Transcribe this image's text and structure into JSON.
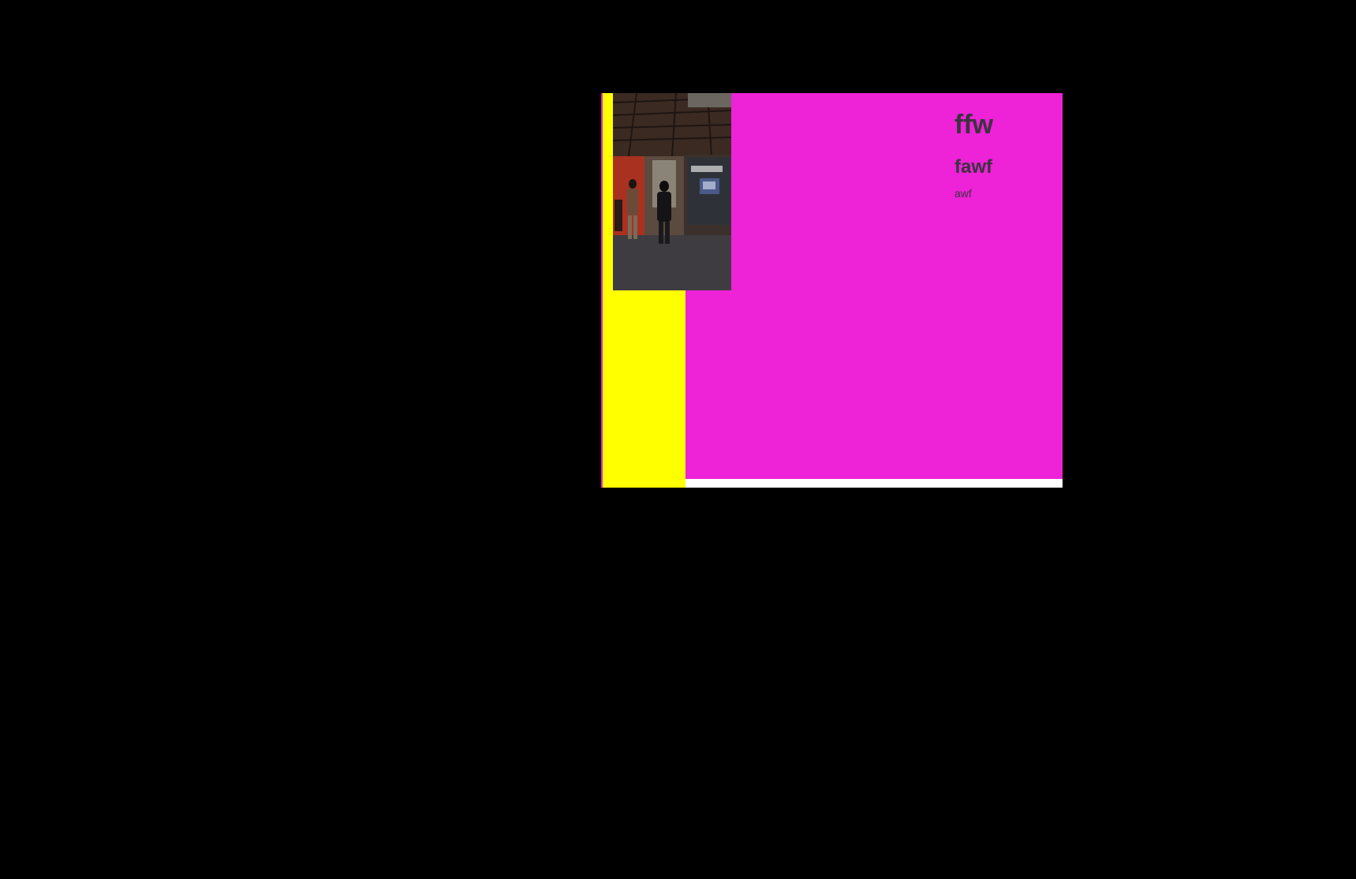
{
  "content": {
    "title": "ffw",
    "subtitle": "fawf",
    "body": "awf"
  },
  "colors": {
    "background": "#000000",
    "main_panel": "#ee22d6",
    "left_rail": "#ffff00",
    "strip": "#ffffff",
    "text": "#3a3340"
  },
  "image": {
    "icon": "photo-of-presentation-room"
  }
}
